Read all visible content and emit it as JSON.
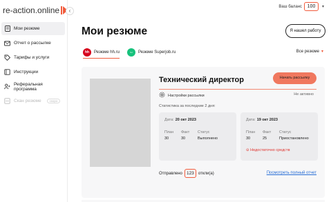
{
  "app": {
    "logo_text": "re-action.online"
  },
  "sidebar": {
    "items": [
      {
        "label": "Мои резюме",
        "icon": "document-icon",
        "active": true
      },
      {
        "label": "Отчет о рассылке",
        "icon": "envelope-icon"
      },
      {
        "label": "Тарифы и услуги",
        "icon": "tag-icon"
      },
      {
        "label": "Инструкции",
        "icon": "book-icon"
      },
      {
        "label": "Реферальная программа",
        "icon": "add-user-icon"
      },
      {
        "label": "Скан резюме",
        "icon": "scan-icon",
        "disabled": true,
        "badge": "скоро"
      }
    ]
  },
  "header": {
    "balance_label": "Ваш баланс",
    "balance_value": "100"
  },
  "main": {
    "title": "Мои резюме",
    "found_job_button": "Я нашел работу",
    "tabs": [
      {
        "label": "Резюме hh.ru",
        "logo": "hh",
        "active": true
      },
      {
        "label": "Резюме Superjob.ru",
        "logo": "superjob"
      }
    ],
    "filter_label": "Все резюме",
    "resume": {
      "title": "Технический директор",
      "start_button": "Начать рассылку",
      "settings_label": "Настройки рассылки",
      "status": "Не активно",
      "stats_title": "Статистика за последние 2 дня:",
      "stats": [
        {
          "date_label": "Дата:",
          "date": "20 окт 2023",
          "plan_label": "План",
          "plan": "30",
          "fact_label": "Факт",
          "fact": "30",
          "status_label": "Статус",
          "status": "Выполнено",
          "warning": ""
        },
        {
          "date_label": "Дата:",
          "date": "19 окт 2023",
          "plan_label": "План",
          "plan": "30",
          "fact_label": "Факт",
          "fact": "25",
          "status_label": "Статус",
          "status": "Приостановлено",
          "warning": "Недостаточно средств"
        }
      ],
      "sent_prefix": "Отправлено",
      "sent_count": "123",
      "sent_suffix": "откли(а)",
      "full_report_link": "Посмотреть полный отчет"
    }
  },
  "colors": {
    "accent": "#f15a3b",
    "button": "#f0785f",
    "link": "#2a6fd6",
    "warning": "#e0312b"
  }
}
